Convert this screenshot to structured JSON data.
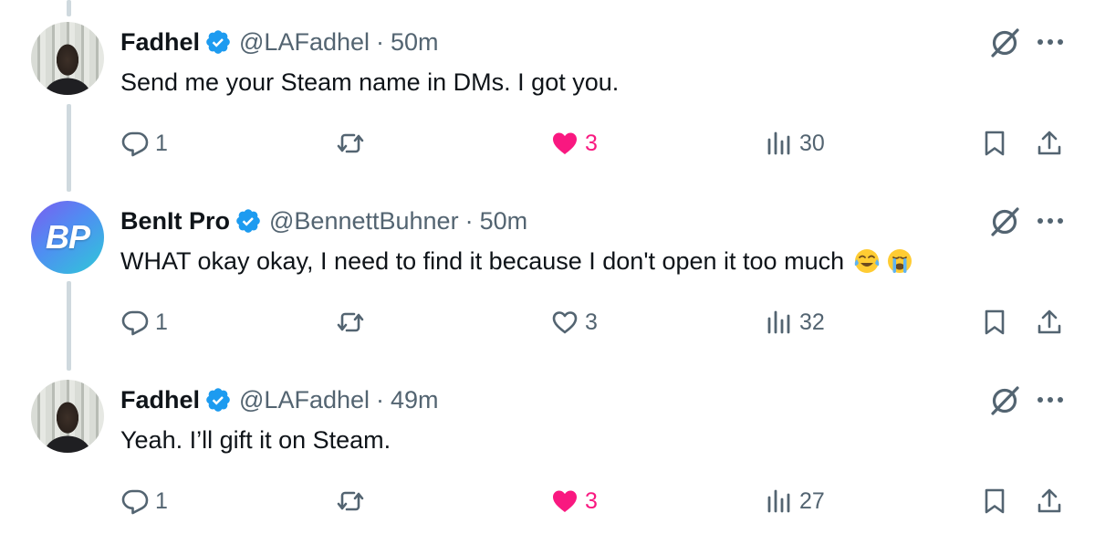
{
  "colors": {
    "text": "#0f1419",
    "secondary": "#536471",
    "verified": "#1d9bf0",
    "like": "#f91880",
    "thread_line": "#cfd9de"
  },
  "tweets": [
    {
      "name": "Fadhel",
      "handle": "@LAFadhel",
      "separator": "·",
      "time": "50m",
      "avatar": "photo-avatar",
      "verified": true,
      "text": "Send me your Steam name in DMs. I got you.",
      "emojis": [],
      "replies": "1",
      "likes": "3",
      "liked": true,
      "views": "30"
    },
    {
      "name": "BenIt Pro",
      "handle": "@BennettBuhner",
      "separator": "·",
      "time": "50m",
      "avatar": "BP",
      "verified": true,
      "text": "WHAT okay okay, I need to find it because I don't open it too much",
      "emojis": [
        "face-with-tears-of-joy-icon",
        "loudly-crying-face-icon"
      ],
      "replies": "1",
      "likes": "3",
      "liked": false,
      "views": "32"
    },
    {
      "name": "Fadhel",
      "handle": "@LAFadhel",
      "separator": "·",
      "time": "49m",
      "avatar": "photo-avatar",
      "verified": true,
      "text": "Yeah. I’ll gift it on Steam.",
      "emojis": [],
      "replies": "1",
      "likes": "3",
      "liked": true,
      "views": "27"
    }
  ]
}
